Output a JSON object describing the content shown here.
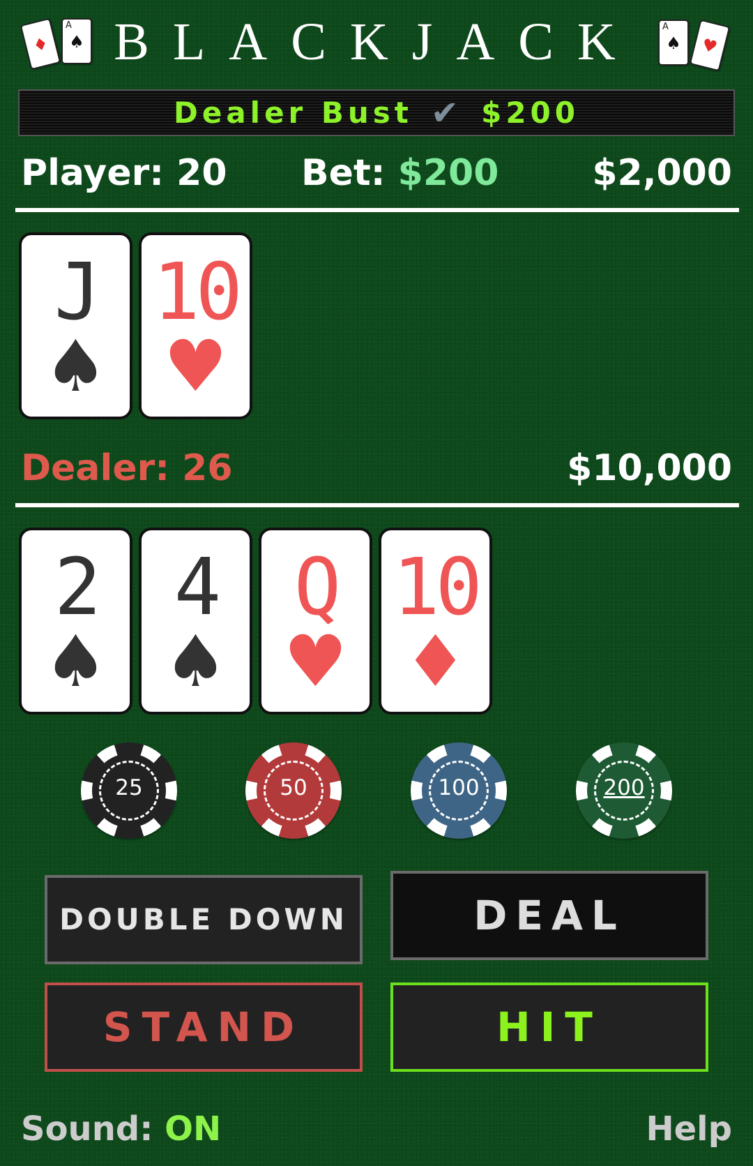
{
  "header": {
    "title": "BLACKJACK",
    "left_cards": [
      {
        "rank": "",
        "suit": "♦",
        "color": "red"
      },
      {
        "rank": "A",
        "suit": "♠",
        "color": "black"
      }
    ],
    "right_cards": [
      {
        "rank": "A",
        "suit": "♠",
        "color": "black"
      },
      {
        "rank": "",
        "suit": "♥",
        "color": "red"
      }
    ]
  },
  "banner": {
    "result": "Dealer Bust",
    "check_icon": "✔",
    "amount": "$200",
    "color": "#8ef22a"
  },
  "player": {
    "label": "Player: 20",
    "bet_label": "Bet: ",
    "bet_amount": "$200",
    "bankroll": "$2,000",
    "cards": [
      {
        "rank": "J",
        "suit": "♠",
        "color": "black"
      },
      {
        "rank": "10",
        "suit": "♥",
        "color": "red"
      }
    ]
  },
  "dealer": {
    "label": "Dealer: 26",
    "bankroll": "$10,000",
    "cards": [
      {
        "rank": "2",
        "suit": "♠",
        "color": "black"
      },
      {
        "rank": "4",
        "suit": "♠",
        "color": "black"
      },
      {
        "rank": "Q",
        "suit": "♥",
        "color": "red"
      },
      {
        "rank": "10",
        "suit": "♦",
        "color": "red"
      }
    ]
  },
  "chips": [
    {
      "value": "25",
      "color": "#222222"
    },
    {
      "value": "50",
      "color": "#b33a3a"
    },
    {
      "value": "100",
      "color": "#3f6586"
    },
    {
      "value": "200",
      "color": "#1e5b34"
    }
  ],
  "buttons": {
    "double_down": "DOUBLE DOWN",
    "deal": "DEAL",
    "stand": "STAND",
    "hit": "HIT"
  },
  "footer": {
    "sound_label": "Sound: ",
    "sound_value": "ON",
    "help": "Help"
  },
  "colors": {
    "felt": "#0e4a1c",
    "accent_green": "#8ef22a",
    "dealer_red": "#de5a4d",
    "bet_green": "#7fe89a"
  }
}
